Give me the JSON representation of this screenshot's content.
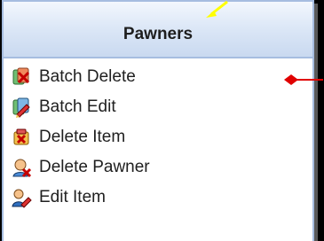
{
  "panel": {
    "title": "Pawners",
    "items": [
      {
        "label": "Batch Delete",
        "icon": "batch-delete-icon"
      },
      {
        "label": "Batch Edit",
        "icon": "batch-edit-icon"
      },
      {
        "label": "Delete Item",
        "icon": "delete-item-icon"
      },
      {
        "label": "Delete Pawner",
        "icon": "delete-pawner-icon"
      },
      {
        "label": "Edit Item",
        "icon": "edit-item-icon"
      }
    ]
  },
  "colors": {
    "header_border": "#a6bde0",
    "annotation_arrow_red": "#e00000",
    "annotation_arrow_yellow": "#ffff00"
  }
}
